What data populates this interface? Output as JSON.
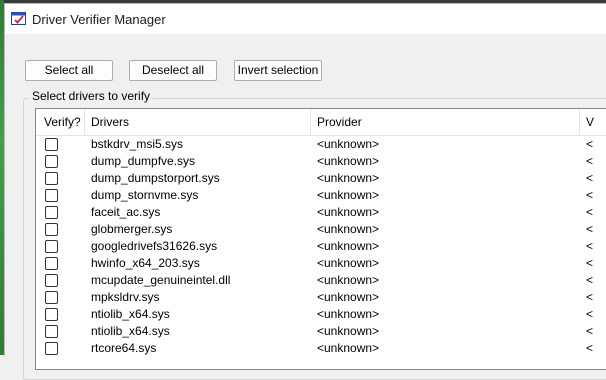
{
  "window": {
    "title": "Driver Verifier Manager"
  },
  "toolbar": {
    "select_all": "Select all",
    "deselect_all": "Deselect all",
    "invert_selection": "Invert selection"
  },
  "group": {
    "label": "Select drivers to verify"
  },
  "table": {
    "columns": [
      "Verify?",
      "Drivers",
      "Provider",
      "V"
    ],
    "rows": [
      {
        "checked": false,
        "driver": "bstkdrv_msi5.sys",
        "provider": "<unknown>",
        "version": "<"
      },
      {
        "checked": false,
        "driver": "dump_dumpfve.sys",
        "provider": "<unknown>",
        "version": "<"
      },
      {
        "checked": false,
        "driver": "dump_dumpstorport.sys",
        "provider": "<unknown>",
        "version": "<"
      },
      {
        "checked": false,
        "driver": "dump_stornvme.sys",
        "provider": "<unknown>",
        "version": "<"
      },
      {
        "checked": false,
        "driver": "faceit_ac.sys",
        "provider": "<unknown>",
        "version": "<"
      },
      {
        "checked": false,
        "driver": "globmerger.sys",
        "provider": "<unknown>",
        "version": "<"
      },
      {
        "checked": false,
        "driver": "googledrivefs31626.sys",
        "provider": "<unknown>",
        "version": "<"
      },
      {
        "checked": false,
        "driver": "hwinfo_x64_203.sys",
        "provider": "<unknown>",
        "version": "<"
      },
      {
        "checked": false,
        "driver": "mcupdate_genuineintel.dll",
        "provider": "<unknown>",
        "version": "<"
      },
      {
        "checked": false,
        "driver": "mpksldrv.sys",
        "provider": "<unknown>",
        "version": "<"
      },
      {
        "checked": false,
        "driver": "ntiolib_x64.sys",
        "provider": "<unknown>",
        "version": "<"
      },
      {
        "checked": false,
        "driver": "ntiolib_x64.sys",
        "provider": "<unknown>",
        "version": "<"
      },
      {
        "checked": false,
        "driver": "rtcore64.sys",
        "provider": "<unknown>",
        "version": "<"
      }
    ]
  },
  "colors": {
    "window_bg": "#f0f0f0",
    "titlebar_bg": "#ffffff",
    "list_bg": "#ffffff",
    "button_border": "#adadad"
  },
  "icons": {
    "app": "driver-verifier-app-icon"
  }
}
